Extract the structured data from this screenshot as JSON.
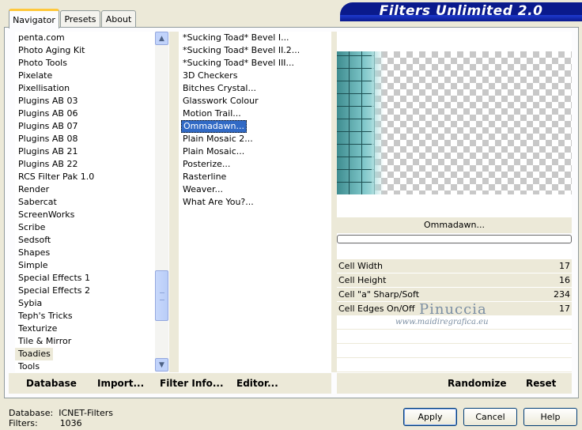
{
  "tabs": [
    "Navigator",
    "Presets",
    "About"
  ],
  "app_title": "Filters Unlimited 2.0",
  "categories": [
    "penta.com",
    "Photo Aging Kit",
    "Photo Tools",
    "Pixelate",
    "Pixellisation",
    "Plugins AB 03",
    "Plugins AB 06",
    "Plugins AB 07",
    "Plugins AB 08",
    "Plugins AB 21",
    "Plugins AB 22",
    "RCS Filter Pak 1.0",
    "Render",
    "Sabercat",
    "ScreenWorks",
    "Scribe",
    "Sedsoft",
    "Shapes",
    "Simple",
    "Special Effects 1",
    "Special Effects 2",
    "Sybia",
    "Teph's Tricks",
    "Texturize",
    "Tile & Mirror",
    "Toadies",
    "Tools"
  ],
  "selected_category": "Toadies",
  "filters": [
    "*Sucking Toad*  Bevel I...",
    "*Sucking Toad*  Bevel II.2...",
    "*Sucking Toad*  Bevel III...",
    "3D Checkers",
    "Bitches Crystal...",
    "Glasswork Colour",
    "Motion Trail...",
    "Ommadawn...",
    "Plain Mosaic 2...",
    "Plain Mosaic...",
    "Posterize...",
    "Rasterline",
    "Weaver...",
    "What Are You?..."
  ],
  "selected_filter": "Ommadawn...",
  "preview_filter_name": "Ommadawn...",
  "params": [
    {
      "label": "Cell Width",
      "value": "17"
    },
    {
      "label": "Cell Height",
      "value": "16"
    },
    {
      "label": "Cell \"a\" Sharp/Soft",
      "value": "234"
    },
    {
      "label": "Cell Edges On/Off",
      "value": "17"
    }
  ],
  "watermark": {
    "name": "Pinuccia",
    "url": "www.maidiregrafica.eu"
  },
  "toolbar": {
    "database": "Database",
    "import": "Import...",
    "filter_info": "Filter Info...",
    "editor": "Editor...",
    "randomize": "Randomize",
    "reset": "Reset"
  },
  "status": {
    "database_label": "Database:",
    "database_value": "ICNET-Filters",
    "filters_label": "Filters:",
    "filters_value": "1036"
  },
  "buttons": {
    "apply": "Apply",
    "cancel": "Cancel",
    "help": "Help"
  },
  "icons": {
    "scroll_up": "chevron-up-icon",
    "scroll_down": "chevron-down-icon"
  }
}
